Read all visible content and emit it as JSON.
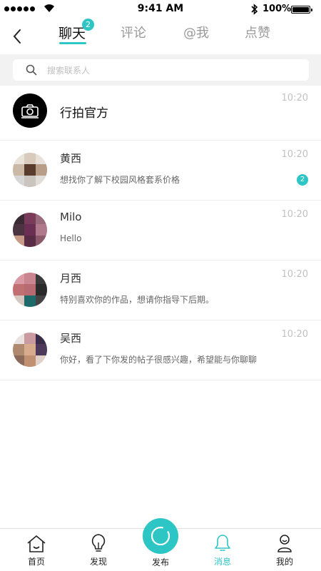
{
  "status_bar": {
    "time": "9:41 AM",
    "battery": "100%"
  },
  "header": {
    "tabs": [
      {
        "label": "聊天",
        "active": true,
        "badge": "2"
      },
      {
        "label": "评论",
        "active": false
      },
      {
        "label": "@我",
        "active": false
      },
      {
        "label": "点赞",
        "active": false
      }
    ]
  },
  "search": {
    "placeholder": "搜索联系人"
  },
  "conversations": [
    {
      "name": "行拍官方",
      "message": "",
      "time": "10:20",
      "badge": ""
    },
    {
      "name": "黄西",
      "message": "想找你了解下校园风格套系价格",
      "time": "10:20",
      "badge": "2"
    },
    {
      "name": "Milo",
      "message": "Hello",
      "time": "10:20",
      "badge": ""
    },
    {
      "name": "月西",
      "message": "特别喜欢你的作品，想请你指导下后期。",
      "time": "10:20",
      "badge": ""
    },
    {
      "name": "吴西",
      "message": "你好，看了下你发的帖子很感兴趣，希望能与你聊聊",
      "time": "10:20",
      "badge": ""
    }
  ],
  "bottom_nav": {
    "items": [
      {
        "label": "首页",
        "icon": "home-icon"
      },
      {
        "label": "发现",
        "icon": "lightbulb-icon"
      },
      {
        "label": "发布",
        "icon": "publish-icon"
      },
      {
        "label": "消息",
        "icon": "bell-icon",
        "active": true
      },
      {
        "label": "我的",
        "icon": "user-icon"
      }
    ]
  },
  "colors": {
    "accent": "#2ec5c5"
  }
}
